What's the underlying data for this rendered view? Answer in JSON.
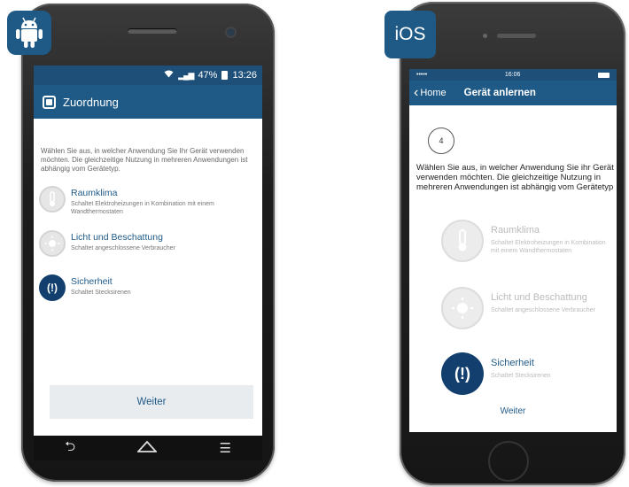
{
  "android": {
    "status": {
      "percent": "47%",
      "time": "13:26"
    },
    "appbar_title": "Zuordnung",
    "description": "Wählen Sie aus, in welcher Anwendung Sie Ihr Gerät verwenden möchten. Die gleichzeitige Nutzung in mehreren Anwendungen ist abhängig vom Gerätetyp.",
    "options": [
      {
        "name": "Raumklima",
        "sub": "Schaltet Elektroheizungen in Kombination mit einem Wandthermostaten",
        "icon": "thermometer-icon",
        "state": "dim"
      },
      {
        "name": "Licht und Beschattung",
        "sub": "Schaltet angeschlossene Verbraucher",
        "icon": "sun-icon",
        "state": "dim"
      },
      {
        "name": "Sicherheit",
        "sub": "Schaltet Stecksirenen",
        "icon": "siren-icon",
        "state": "active"
      }
    ],
    "button_label": "Weiter",
    "nav": [
      "back-icon",
      "home-icon",
      "menu-icon"
    ]
  },
  "ios": {
    "badge": "iOS",
    "status": {
      "carrier": "••••• ",
      "time": "16:06"
    },
    "back_label": "Home",
    "nav_title": "Gerät anlernen",
    "step": "4",
    "description": "Wählen Sie aus, in welcher Anwendung Sie ihr Gerät verwenden möchten. Die gleichzeitige Nutzung in mehreren Anwendungen ist abhängig vom Gerätetyp",
    "options": [
      {
        "name": "Raumklima",
        "sub": "Schaltet Elektroheizungen in Kombination mit einem Wandthermostaten",
        "icon": "thermometer-icon",
        "state": "dim"
      },
      {
        "name": "Licht und Beschattung",
        "sub": "Schaltet angeschlossene Verbraucher",
        "icon": "sun-icon",
        "state": "dim"
      },
      {
        "name": "Sicherheit",
        "sub": "Schaltet Stecksirenen",
        "icon": "siren-icon",
        "state": "active"
      }
    ],
    "button_label": "Weiter"
  },
  "colors": {
    "primary": "#1f5a87",
    "status_bar": "#1d4f78",
    "active_icon": "#123f6d",
    "button_bg": "#e9ecef"
  }
}
